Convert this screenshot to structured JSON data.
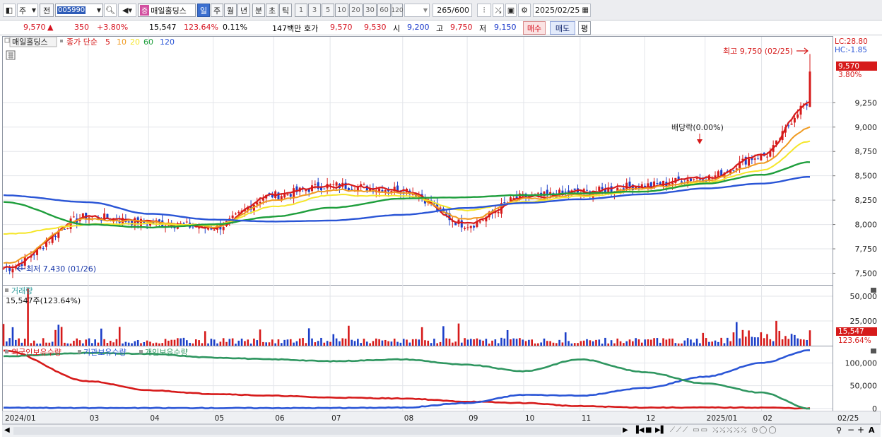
{
  "toolbar": {
    "period_select": "주",
    "jeon_label": "전",
    "stock_code": "005990",
    "name_tag": "증",
    "stock_name": "매일홀딩스",
    "periods": [
      "일",
      "주",
      "월",
      "년",
      "분",
      "초",
      "틱"
    ],
    "active_period": "일",
    "intervals": [
      "1",
      "3",
      "5",
      "10",
      "20",
      "30",
      "60",
      "120"
    ],
    "count_value": "265",
    "count_total": "/600",
    "date_value": "2025/02/25"
  },
  "infobar": {
    "price": "9,570",
    "change_symbol": "▲",
    "change": "350",
    "change_pct": "+3.80%",
    "volume": "15,547",
    "volume_ratio": "123.64%",
    "turnover": "0.11%",
    "amount": "147백만",
    "quote_label": "호가",
    "ask": "9,570",
    "bid": "9,530",
    "open_label": "시",
    "open": "9,200",
    "high_label": "고",
    "high": "9,750",
    "low_label": "저",
    "low": "9,150",
    "buy_label": "매수",
    "sell_label": "매도",
    "avg_label": "평"
  },
  "legend": {
    "stock": "매일홀딩스",
    "title": "종가 단순",
    "ma5": "5",
    "ma10": "10",
    "ma20": "20",
    "ma60": "60",
    "ma120": "120"
  },
  "colors": {
    "ma5": "#d61a1a",
    "ma10": "#f09a1f",
    "ma20": "#f5e62a",
    "ma60": "#1e9e3c",
    "ma120": "#2a55d6",
    "up": "#d61a1a",
    "down": "#1c3fc8",
    "foreign": "#d61a1a",
    "institution": "#2a55d6",
    "individual": "#2f9660"
  },
  "annotations": {
    "lc": "LC:28.80",
    "hc": "HC:-1.85",
    "high_note": "최고 9,750 (02/25)",
    "low_note": "최저 7,430 (01/26)",
    "dividend": "배당락(0.00%)",
    "price_tag": "9,570",
    "pct_tag": "3.80%",
    "volume_tag": "15,547",
    "volume_pct_tag": "123.64%"
  },
  "volume_panel": {
    "title": "거래량",
    "value": "15,547주(123.64%)"
  },
  "investor_panel": {
    "foreign": "외국인보유수량",
    "institution": "기관보유수량",
    "individual": "개인보유수량"
  },
  "chart_data": [
    {
      "type": "line",
      "title": "",
      "y_ticks": [
        "9,250",
        "9,000",
        "8,750",
        "8,500",
        "8,250",
        "8,000",
        "7,750",
        "7,500"
      ],
      "ylim": [
        7380,
        9920
      ],
      "series": [
        {
          "name": "5",
          "x": [
            "2024/01",
            "03",
            "04",
            "05",
            "06",
            "07",
            "08",
            "09",
            "10",
            "11",
            "12",
            "2025/01",
            "02",
            "02/25"
          ],
          "y": [
            7550,
            8080,
            8020,
            7970,
            8300,
            8400,
            8360,
            8000,
            8280,
            8330,
            8400,
            8480,
            8700,
            9250
          ]
        },
        {
          "name": "10",
          "x": [
            "2024/01",
            "03",
            "04",
            "05",
            "06",
            "07",
            "08",
            "09",
            "10",
            "11",
            "12",
            "2025/01",
            "02",
            "02/25"
          ],
          "y": [
            7600,
            8050,
            8030,
            7980,
            8250,
            8350,
            8330,
            8050,
            8260,
            8310,
            8370,
            8450,
            8620,
            9000
          ]
        },
        {
          "name": "20",
          "x": [
            "2024/01",
            "03",
            "04",
            "05",
            "06",
            "07",
            "08",
            "09",
            "10",
            "11",
            "12",
            "2025/01",
            "02",
            "02/25"
          ],
          "y": [
            7900,
            8000,
            8010,
            7990,
            8180,
            8300,
            8300,
            8150,
            8230,
            8290,
            8340,
            8430,
            8560,
            8850
          ]
        },
        {
          "name": "60",
          "x": [
            "2024/01",
            "03",
            "04",
            "05",
            "06",
            "07",
            "08",
            "09",
            "10",
            "11",
            "12",
            "2025/01",
            "02",
            "02/25"
          ],
          "y": [
            8230,
            8000,
            7970,
            8000,
            8080,
            8170,
            8270,
            8280,
            8300,
            8320,
            8340,
            8420,
            8510,
            8640
          ]
        },
        {
          "name": "120",
          "x": [
            "2024/01",
            "03",
            "04",
            "05",
            "06",
            "07",
            "08",
            "09",
            "10",
            "11",
            "12",
            "2025/01",
            "02",
            "02/25"
          ],
          "y": [
            8300,
            8230,
            8110,
            8050,
            8030,
            8040,
            8100,
            8170,
            8220,
            8260,
            8310,
            8370,
            8420,
            8490
          ]
        }
      ]
    },
    {
      "type": "bar",
      "title": "거래량",
      "y_ticks": [
        "50,000",
        "25,000"
      ],
      "ylim": [
        0,
        60000
      ],
      "series": [
        {
          "name": "거래량",
          "last": 15547
        }
      ]
    },
    {
      "type": "line",
      "title": "",
      "y_ticks": [
        "100,000",
        "50,000",
        "0"
      ],
      "ylim": [
        -5000,
        135000
      ],
      "x_labels": [
        "2024/01",
        "03",
        "04",
        "05",
        "06",
        "07",
        "08",
        "09",
        "10",
        "11",
        "12",
        "2025/01",
        "02",
        "02/25"
      ],
      "series": [
        {
          "name": "외국인보유수량",
          "y": [
            128000,
            60000,
            40000,
            32000,
            28000,
            24000,
            22000,
            15000,
            12000,
            5000,
            2000,
            2000,
            2000,
            0
          ]
        },
        {
          "name": "기관보유수량",
          "y": [
            2000,
            1000,
            1000,
            1000,
            1000,
            1000,
            2000,
            12000,
            30000,
            28000,
            45000,
            70000,
            100000,
            128000
          ]
        },
        {
          "name": "개인보유수량",
          "y": [
            115000,
            122000,
            120000,
            112000,
            108000,
            104000,
            108000,
            96000,
            82000,
            108000,
            80000,
            55000,
            35000,
            0
          ]
        }
      ]
    }
  ],
  "x_axis": [
    "2024/01",
    "03",
    "04",
    "05",
    "06",
    "07",
    "08",
    "09",
    "10",
    "11",
    "12",
    "2025/01",
    "02",
    "02/25"
  ]
}
